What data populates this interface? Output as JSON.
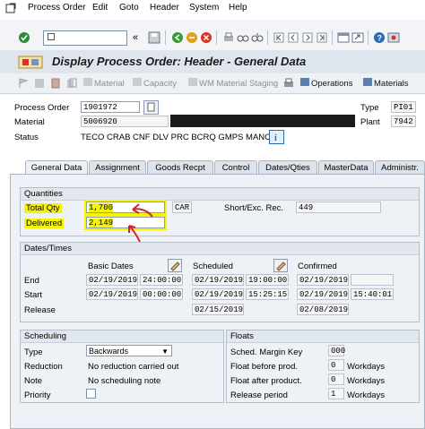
{
  "menu": [
    "Process Order",
    "Edit",
    "Goto",
    "Header",
    "System",
    "Help"
  ],
  "title": "Display Process Order: Header - General Data",
  "app_toolbar": {
    "material": "Material",
    "capacity": "Capacity",
    "wm_staging": "WM Material Staging",
    "operations": "Operations",
    "materials": "Materials"
  },
  "header": {
    "process_order_label": "Process Order",
    "process_order": "1901972",
    "type_label": "Type",
    "type": "PI01",
    "material_label": "Material",
    "material": "5006920",
    "plant_label": "Plant",
    "plant": "7942",
    "status_label": "Status",
    "status": "TECO CRAB CNF  DLV  PRC  BCRQ GMPS MANC*"
  },
  "tabs": [
    "General Data",
    "Assignment",
    "Goods Recpt",
    "Control",
    "Dates/Qties",
    "MasterData",
    "Administr."
  ],
  "quantities": {
    "title": "Quantities",
    "total_qty_label": "Total Qty",
    "total_qty": "1,700",
    "unit": "CAR",
    "short_exc_label": "Short/Exc. Rec.",
    "short_exc": "449",
    "delivered_label": "Delivered",
    "delivered": "2,149"
  },
  "dates": {
    "title": "Dates/Times",
    "basic_label": "Basic Dates",
    "scheduled_label": "Scheduled",
    "confirmed_label": "Confirmed",
    "end_label": "End",
    "start_label": "Start",
    "release_label": "Release",
    "basic_end_date": "02/19/2019",
    "basic_end_time": "24:00:00",
    "basic_start_date": "02/19/2019",
    "basic_start_time": "00:00:00",
    "sched_end_date": "02/19/2019",
    "sched_end_time": "19:00:00",
    "sched_start_date": "02/19/2019",
    "sched_start_time": "15:25:15",
    "sched_release_date": "02/15/2019",
    "conf_end_date": "02/19/2019",
    "conf_start_date": "02/19/2019",
    "conf_start_time": "15:40:01",
    "conf_release_date": "02/08/2019"
  },
  "scheduling": {
    "title": "Scheduling",
    "type_label": "Type",
    "type_value": "Backwards",
    "reduction_label": "Reduction",
    "reduction_value": "No reduction carried out",
    "note_label": "Note",
    "note_value": "No scheduling note",
    "priority_label": "Priority"
  },
  "floats": {
    "title": "Floats",
    "margin_key_label": "Sched. Margin Key",
    "margin_key": "000",
    "before_label": "Float before prod.",
    "before_value": "0",
    "after_label": "Float after product.",
    "after_value": "0",
    "release_period_label": "Release period",
    "release_period_value": "1",
    "unit": "Workdays"
  },
  "colors": {
    "highlight": "#f6f500",
    "annotation_arrow": "#d0262a",
    "tab_panel": "#eef1f5"
  }
}
